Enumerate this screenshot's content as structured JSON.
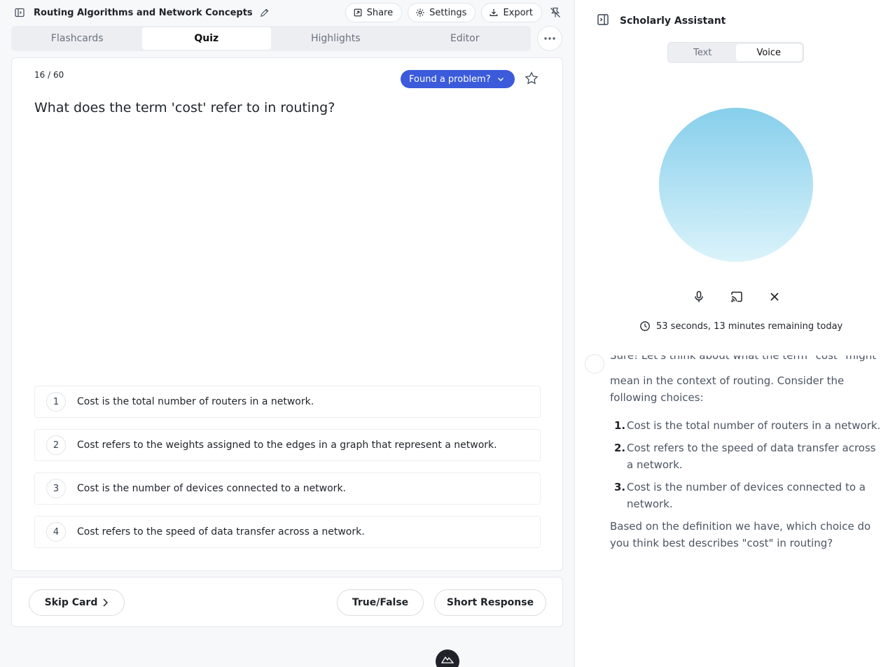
{
  "header": {
    "title": "Routing Algorithms and Network Concepts",
    "share_label": "Share",
    "settings_label": "Settings",
    "export_label": "Export"
  },
  "tabs": [
    {
      "label": "Flashcards"
    },
    {
      "label": "Quiz"
    },
    {
      "label": "Highlights"
    },
    {
      "label": "Editor"
    }
  ],
  "card": {
    "counter": "16 / 60",
    "problem_label": "Found a problem?",
    "question": "What does the term 'cost' refer to in routing?",
    "choices": [
      {
        "num": "1",
        "text": "Cost is the total number of routers in a network."
      },
      {
        "num": "2",
        "text": "Cost refers to the weights assigned to the edges in a graph that represent a network."
      },
      {
        "num": "3",
        "text": "Cost is the number of devices connected to a network."
      },
      {
        "num": "4",
        "text": "Cost refers to the speed of data transfer across a network."
      }
    ]
  },
  "bottom": {
    "skip_label": "Skip Card",
    "true_false_label": "True/False",
    "short_response_label": "Short Response"
  },
  "assistant": {
    "title": "Scholarly Assistant",
    "mode_text": "Text",
    "mode_voice": "Voice",
    "timer": "53 seconds, 13 minutes remaining today",
    "message": {
      "clipped_line": "Sure! Let's think about what the term \"cost\" might",
      "intro": "mean in the context of routing. Consider the following choices:",
      "items": [
        {
          "n": "1.",
          "text": "Cost is the total number of routers in a network."
        },
        {
          "n": "2.",
          "text": "Cost refers to the speed of data transfer across a network."
        },
        {
          "n": "3.",
          "text": "Cost is the number of devices connected to a network."
        }
      ],
      "closing": "Based on the definition we have, which choice do you think best describes \"cost\" in routing?"
    }
  },
  "colors": {
    "accent": "#3b5bdb",
    "orb_top": "#86cfeb",
    "orb_bottom": "#dbf3fb"
  }
}
